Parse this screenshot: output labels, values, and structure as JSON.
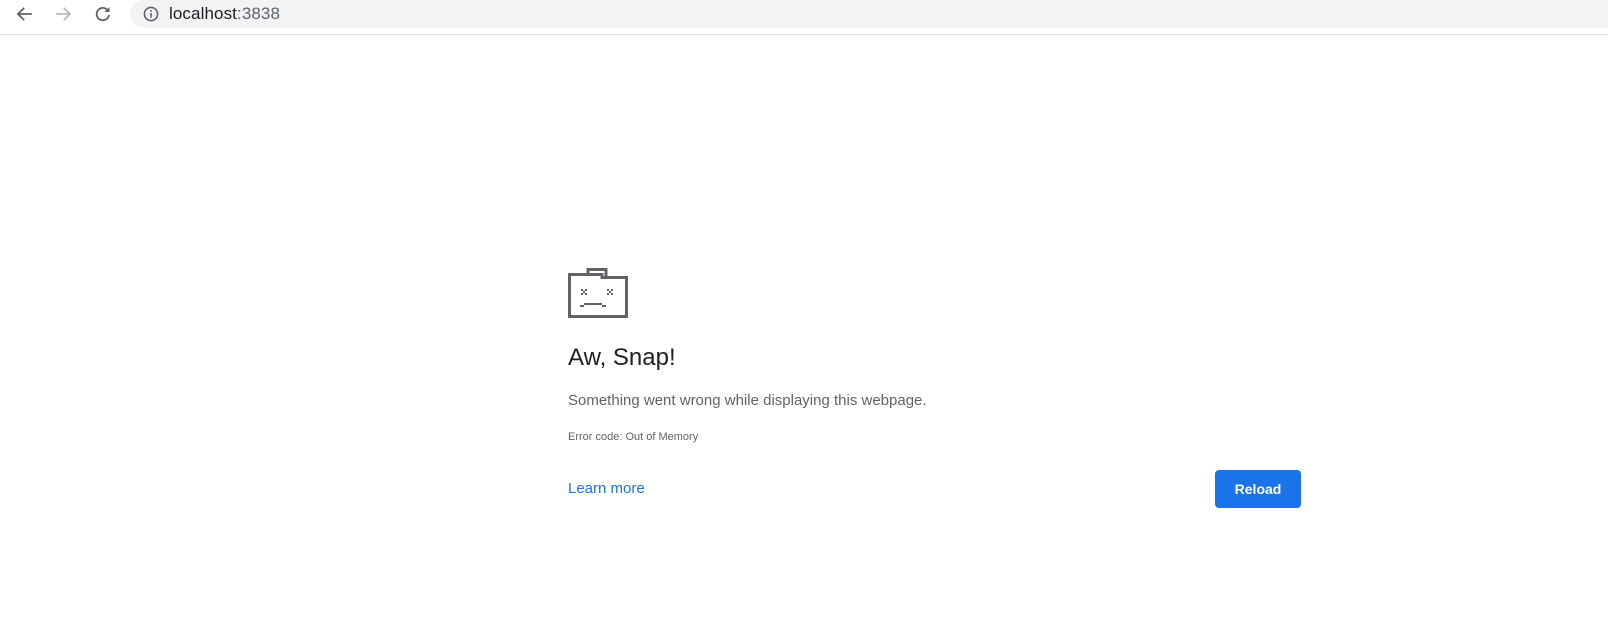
{
  "browser": {
    "url_host": "localhost",
    "url_port": ":3838",
    "icons": {
      "back": "arrow-left-icon",
      "forward": "arrow-right-icon",
      "reload": "refresh-icon",
      "site_info": "info-icon"
    },
    "colors": {
      "toolbar_icon": "#5f6368",
      "toolbar_icon_disabled": "#b8b8b8",
      "omnibox_bg": "#f1f3f4"
    }
  },
  "error_page": {
    "icon": "sad-folder-icon",
    "title": "Aw, Snap!",
    "message": "Something went wrong while displaying this webpage.",
    "error_code": "Error code: Out of Memory",
    "learn_more_label": "Learn more",
    "reload_label": "Reload",
    "colors": {
      "accent": "#1a73e8",
      "title_text": "#202124",
      "body_text": "#5f6368"
    }
  }
}
